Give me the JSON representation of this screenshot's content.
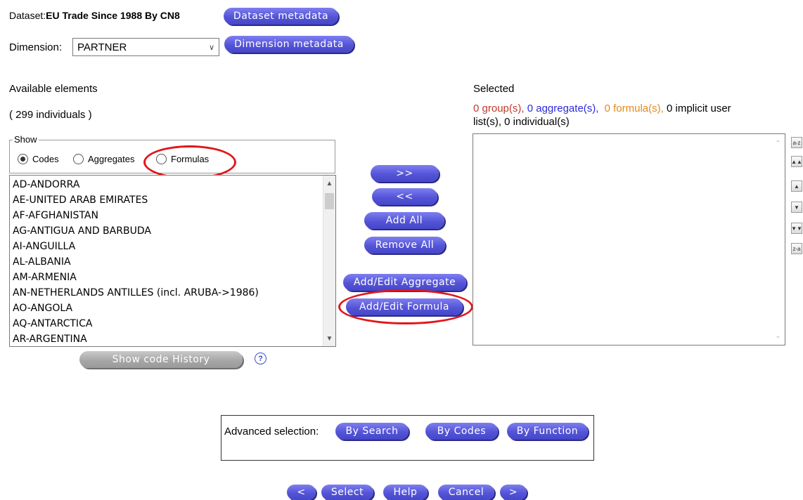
{
  "header": {
    "dataset_label": "Dataset:",
    "dataset_name": "EU Trade Since 1988 By CN8",
    "dataset_metadata_button": "Dataset metadata",
    "dimension_label": "Dimension:",
    "dimension_value": "PARTNER",
    "dimension_metadata_button": "Dimension metadata"
  },
  "available": {
    "title": "Available elements",
    "count": "( 299 individuals )",
    "show_legend": "Show",
    "radios": [
      {
        "label": "Codes",
        "checked": true
      },
      {
        "label": "Aggregates",
        "checked": false
      },
      {
        "label": "Formulas",
        "checked": false
      }
    ],
    "items": [
      "AD-ANDORRA",
      "AE-UNITED ARAB EMIRATES",
      "AF-AFGHANISTAN",
      "AG-ANTIGUA AND BARBUDA",
      "AI-ANGUILLA",
      "AL-ALBANIA",
      "AM-ARMENIA",
      "AN-NETHERLANDS ANTILLES (incl. ARUBA->1986)",
      "AO-ANGOLA",
      "AQ-ANTARCTICA",
      "AR-ARGENTINA"
    ],
    "show_code_history_button": "Show code History",
    "help_glyph": "?"
  },
  "middle_buttons": {
    "add": ">>",
    "remove": "<<",
    "add_all": "Add All",
    "remove_all": "Remove All",
    "aggregate": "Add/Edit Aggregate",
    "formula": "Add/Edit Formula"
  },
  "selected": {
    "title": "Selected",
    "groups": "0 group(s),",
    "aggregates": "0 aggregate(s),",
    "formulas": "0 formula(s),",
    "implicit": "0 implicit user",
    "rest": "list(s), 0 individual(s)",
    "sort_buttons": [
      "a-z",
      "▲▲",
      "▲",
      "▼",
      "▼▼",
      "z-a"
    ]
  },
  "advanced": {
    "label": "Advanced selection:",
    "by_search": "By Search",
    "by_codes": "By Codes",
    "by_function": "By Function"
  },
  "footer": {
    "prev": "<",
    "select": "Select",
    "help": "Help",
    "cancel": "Cancel",
    "next": ">"
  },
  "colors": {
    "button": "#5454d8",
    "groups_text": "#c0392b",
    "aggregates_text": "#2a2ad8",
    "formulas_text": "#e08a1e",
    "highlight": "#e0161b"
  }
}
